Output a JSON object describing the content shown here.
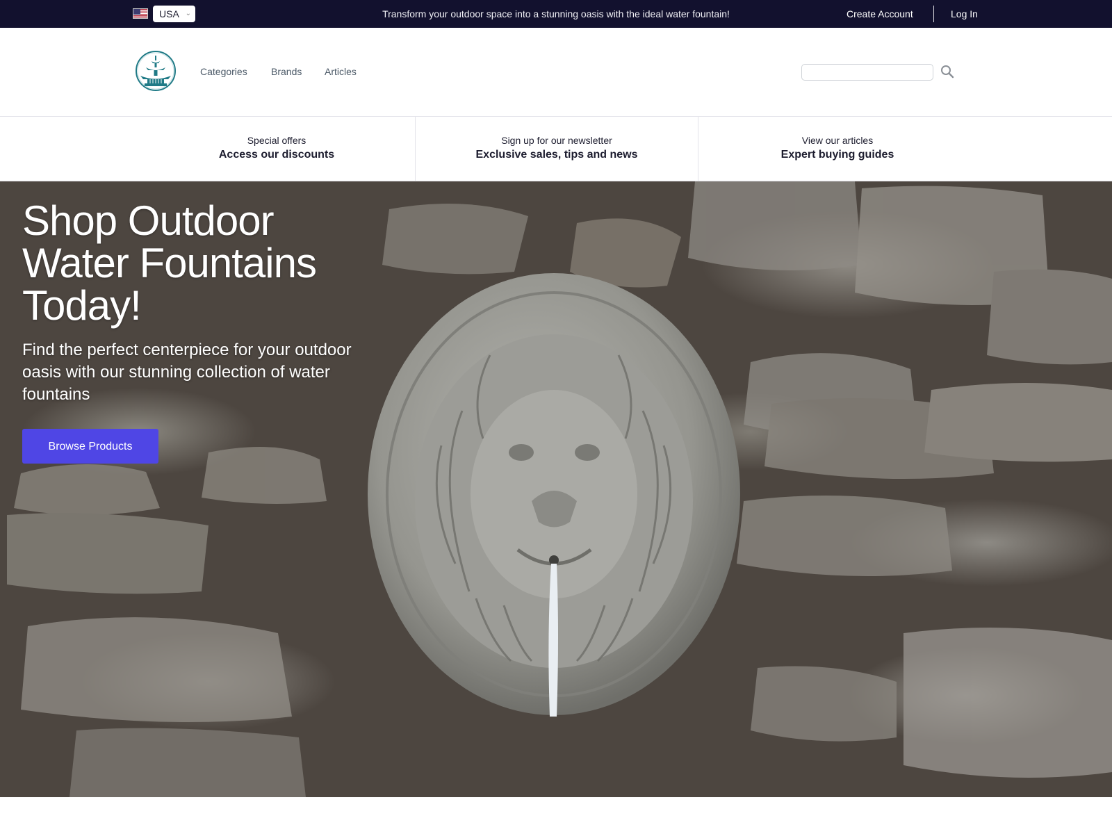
{
  "topbar": {
    "country": "USA",
    "announcement": "Transform your outdoor space into a stunning oasis with the ideal water fountain!",
    "create_account": "Create Account",
    "log_in": "Log In",
    "flag_icon": "us-flag-icon"
  },
  "header": {
    "logo_icon": "fountain-logo-icon",
    "nav": [
      "Categories",
      "Brands",
      "Articles"
    ],
    "search": {
      "placeholder": "",
      "value": ""
    }
  },
  "promo": [
    {
      "small": "Special offers",
      "big": "Access our discounts"
    },
    {
      "small": "Sign up for our newsletter",
      "big": "Exclusive sales, tips and news"
    },
    {
      "small": "View our articles",
      "big": "Expert buying guides"
    }
  ],
  "hero": {
    "title": "Shop Outdoor Water Fountains Today!",
    "subtitle": "Find the perfect centerpiece for your outdoor oasis with our stunning collection of water fountains",
    "button": "Browse Products",
    "button_color": "#4f46e5",
    "image": "lion-head-wall-fountain-image"
  },
  "colors": {
    "topbar_bg": "#12112e",
    "nav_text": "#4a5866",
    "logo_teal": "#1f7a86"
  }
}
